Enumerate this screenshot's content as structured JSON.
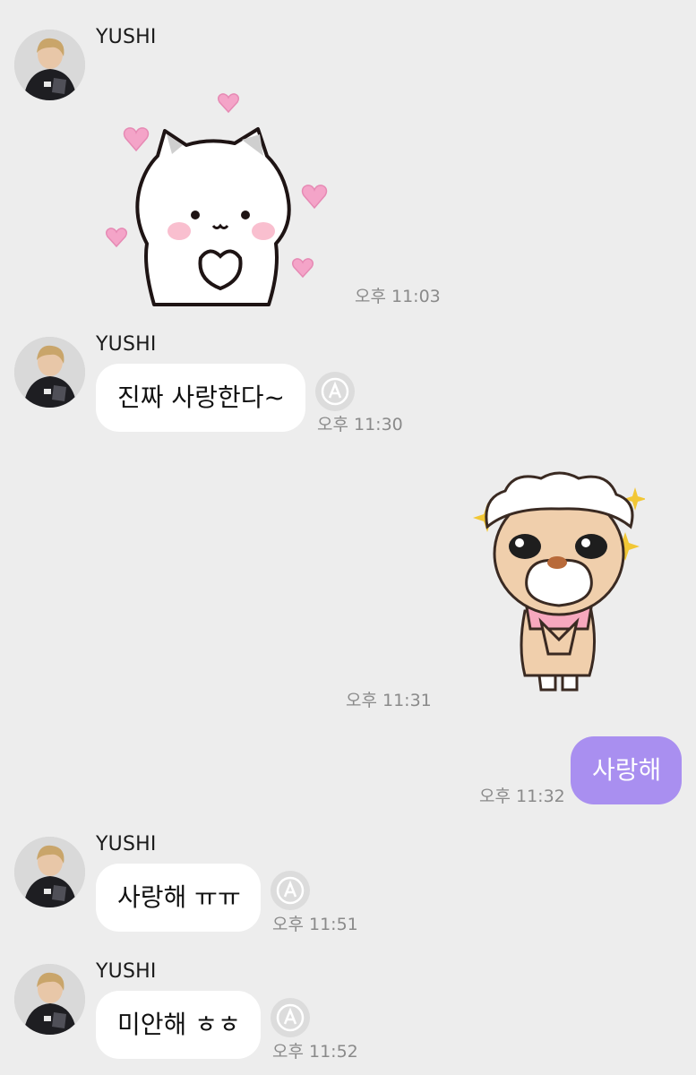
{
  "messages": [
    {
      "sender": "YUSHI",
      "type": "sticker",
      "sticker": "white-cat-hearts-sticker",
      "time": "오후 11:03"
    },
    {
      "sender": "YUSHI",
      "type": "text",
      "text": "진짜 사랑한다~",
      "time": "오후 11:30"
    },
    {
      "sender": "me",
      "type": "sticker",
      "sticker": "sheep-begging-sticker",
      "time": "오후 11:31"
    },
    {
      "sender": "me",
      "type": "text",
      "text": "사랑해",
      "time": "오후 11:32"
    },
    {
      "sender": "YUSHI",
      "type": "text",
      "text": "사랑해 ㅠㅠ",
      "time": "오후 11:51"
    },
    {
      "sender": "YUSHI",
      "type": "text",
      "text": "미안해 ㅎㅎ",
      "time": "오후 11:52"
    }
  ],
  "colors": {
    "background": "#ededed",
    "incoming_bubble": "#ffffff",
    "outgoing_bubble": "#a98ff0",
    "timestamp": "#8a8a8a"
  },
  "icons": {
    "avatar": "profile-photo",
    "translate": "translate-a-icon"
  }
}
